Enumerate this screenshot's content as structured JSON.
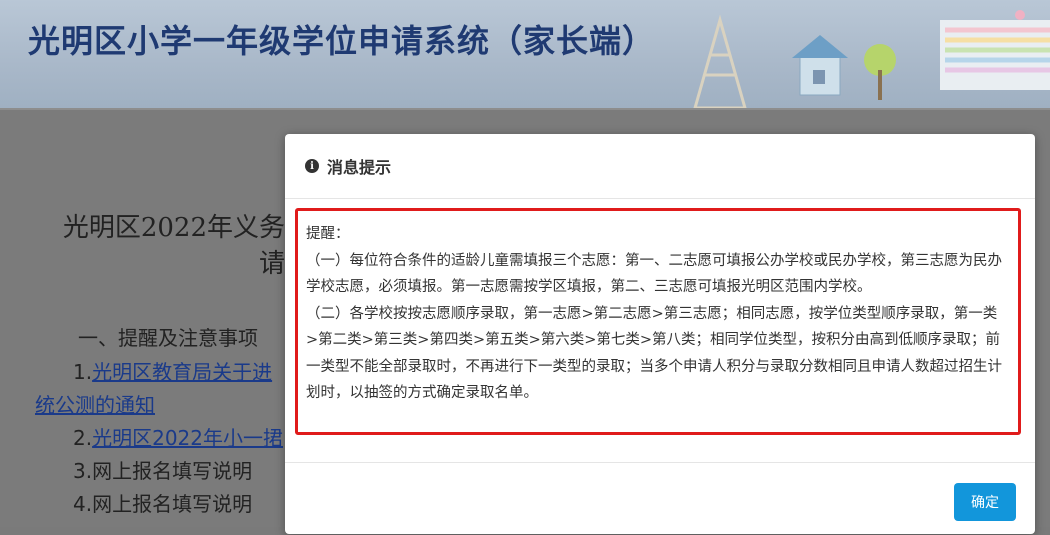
{
  "header": {
    "title": "光明区小学一年级学位申请系统（家长端）"
  },
  "document": {
    "title_line1": "光明区2022年义务",
    "title_line2": "请",
    "section_heading": "一、提醒及注意事项",
    "items": [
      {
        "num": "1.",
        "text": "光明区教育局关于进",
        "link": true
      },
      {
        "num": "",
        "text": "统公测的通知",
        "link": true,
        "continuation": true
      },
      {
        "num": "2.",
        "text": "光明区2022年小一捃",
        "link": true
      },
      {
        "num": "3.",
        "text": "网上报名填写说明",
        "link": false
      },
      {
        "num": "4.",
        "text": "网上报名填写说明",
        "link": true
      }
    ]
  },
  "modal": {
    "title": "消息提示",
    "icon": "info-circle-icon",
    "paragraphs": [
      "提醒：",
      "（一）每位符合条件的适龄儿童需填报三个志愿：第一、二志愿可填报公办学校或民办学校，第三志愿为民办学校志愿，必须填报。第一志愿需按学区填报，第二、三志愿可填报光明区范围内学校。",
      "（二）各学校按按志愿顺序录取，第一志愿>第二志愿>第三志愿；相同志愿，按学位类型顺序录取，第一类>第二类>第三类>第四类>第五类>第六类>第七类>第八类；相同学位类型，按积分由高到低顺序录取；前一类型不能全部录取时，不再进行下一类型的录取；当多个申请人积分与录取分数相同且申请人数超过招生计划时，以抽签的方式确定录取名单。"
    ],
    "ok_label": "确定",
    "highlight_color": "#e01b1b",
    "button_color": "#1296db"
  }
}
